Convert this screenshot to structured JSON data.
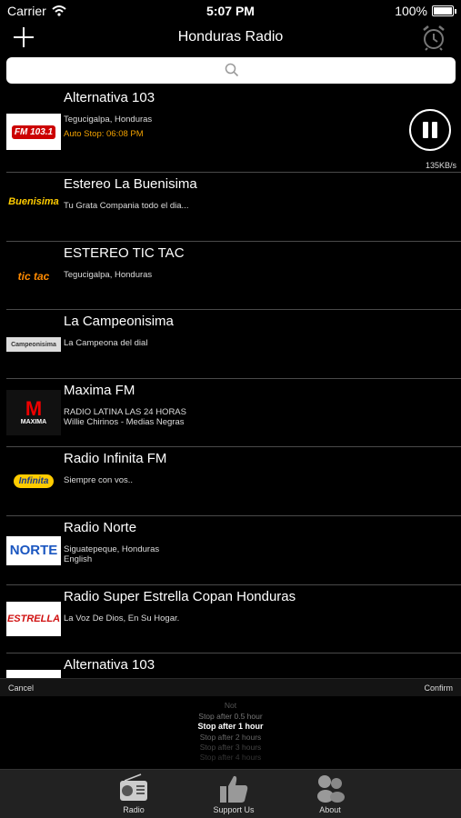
{
  "status": {
    "carrier": "Carrier",
    "time": "5:07 PM",
    "battery": "100%"
  },
  "nav": {
    "title": "Honduras Radio"
  },
  "stations": [
    {
      "name": "Alternativa 103",
      "line1": "Tegucigalpa, Honduras",
      "line2": "",
      "stop": "Auto Stop: 06:08 PM",
      "speed": "135KB/s",
      "logo": "FM 103.1"
    },
    {
      "name": "Estereo La Buenisima",
      "line1": "Tu Grata Compania todo el dia...",
      "line2": "",
      "logo": "Buenisima"
    },
    {
      "name": "ESTEREO TIC TAC",
      "line1": "Tegucigalpa, Honduras",
      "line2": "",
      "logo": "tic tac"
    },
    {
      "name": "La Campeonisima",
      "line1": "La Campeona del dial",
      "line2": "",
      "logo": "Campeonisima"
    },
    {
      "name": "Maxima FM",
      "line1": "RADIO LATINA LAS 24 HORAS",
      "line2": "Willie Chirinos - Medias Negras",
      "logo": "MAXIMA"
    },
    {
      "name": "Radio Infinita FM",
      "line1": "Siempre con vos..",
      "line2": "",
      "logo": "Infinita"
    },
    {
      "name": "Radio Norte",
      "line1": "Siguatepeque, Honduras",
      "line2": "English",
      "logo": "NORTE"
    },
    {
      "name": "Radio Super Estrella Copan Honduras",
      "line1": "La Voz De Dios, En Su Hogar.",
      "line2": "",
      "logo": "ESTRELLA"
    },
    {
      "name": "Alternativa 103",
      "line1": "",
      "line2": "",
      "logo": ""
    }
  ],
  "picker": {
    "cancel": "Cancel",
    "confirm": "Confirm",
    "options": [
      "Not",
      "Stop after 0.5 hour",
      "Stop after 1 hour",
      "Stop after 2 hours",
      "Stop after 3 hours",
      "Stop after 4 hours"
    ],
    "selected_index": 2
  },
  "tabs": [
    {
      "label": "Radio",
      "icon": "radio-icon"
    },
    {
      "label": "Support Us",
      "icon": "thumbs-up-icon"
    },
    {
      "label": "About",
      "icon": "people-icon"
    }
  ],
  "colors": {
    "accent_orange": "#f0a000",
    "background": "#000000",
    "tabbar": "#222222"
  }
}
